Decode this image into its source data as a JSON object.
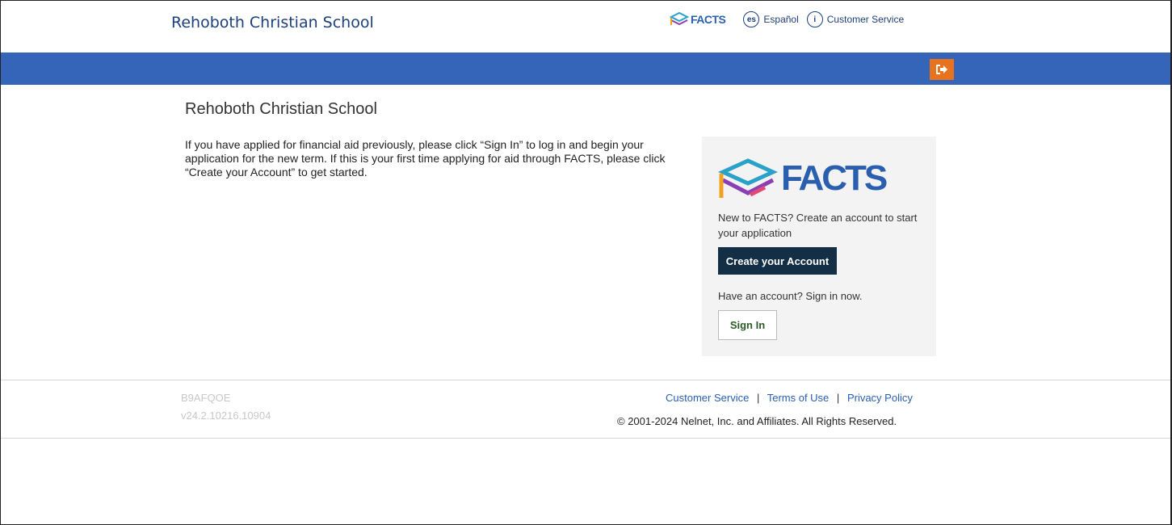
{
  "header": {
    "school_name": "Rehoboth Christian School",
    "logo_text": "FACTS",
    "espanol_icon": "es",
    "espanol_label": "Español",
    "customer_service_label": "Customer Service",
    "info_icon": "i"
  },
  "main": {
    "title": "Rehoboth Christian School",
    "intro": "If you have applied for financial aid previously, please click “Sign In” to log in and begin your application for the new term.  If this is your first time applying for aid through FACTS, please click “Create your Account” to get started."
  },
  "panel": {
    "logo_text": "FACTS",
    "new_text": "New to FACTS? Create an account to start your application",
    "create_button": "Create your Account",
    "have_account_text": "Have an account? Sign in now.",
    "signin_button": "Sign In"
  },
  "footer": {
    "code": "B9AFQOE",
    "version": "v24.2.10216.10904",
    "links": [
      "Customer Service",
      "Terms of Use",
      "Privacy Policy"
    ],
    "separator": "|",
    "copyright": "© 2001-2024 Nelnet, Inc. and Affiliates. All Rights Reserved."
  },
  "colors": {
    "blue_bar": "#3565b8",
    "signout_orange": "#e8731e",
    "create_button_bg": "#132f45",
    "link_blue": "#2a5fb0"
  },
  "icons": {
    "signout": "sign-out-icon",
    "logo": "facts-logo-icon"
  }
}
